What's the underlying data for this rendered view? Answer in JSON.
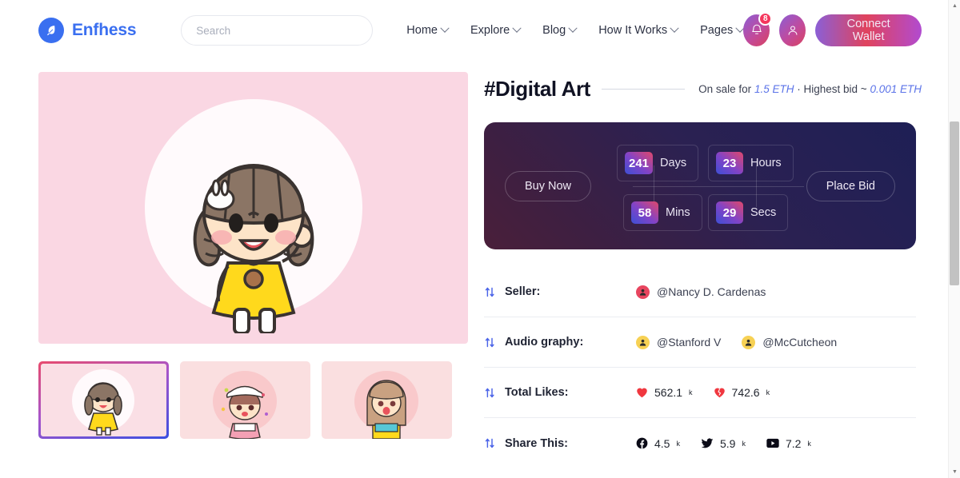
{
  "header": {
    "brand": "Enfhess",
    "brand_icon": "feather-logo-icon",
    "search": {
      "placeholder": "Search",
      "value": ""
    },
    "nav": [
      {
        "label": "Home",
        "has_dropdown": true
      },
      {
        "label": "Explore",
        "has_dropdown": true
      },
      {
        "label": "Blog",
        "has_dropdown": true
      },
      {
        "label": "How It Works",
        "has_dropdown": true
      },
      {
        "label": "Pages",
        "has_dropdown": true
      }
    ],
    "notification": {
      "icon": "bell-icon",
      "count": "8"
    },
    "profile": {
      "icon": "user-icon"
    },
    "wallet_button": "Connect Wallet",
    "accent_gradient_start": "#8b5fd6",
    "accent_gradient_end": "#e0435d"
  },
  "gallery": {
    "main_image_alt": "chibi-girl-yellow-dress",
    "thumbnails": [
      {
        "alt": "chibi-girl-yellow-dress",
        "selected": true
      },
      {
        "alt": "chibi-girl-chef-hat",
        "selected": false
      },
      {
        "alt": "chibi-girl-long-hair",
        "selected": false
      }
    ]
  },
  "detail": {
    "title": "#Digital Art",
    "price_prefix": "On sale for",
    "price": "1.5 ETH",
    "bid_separator": "·",
    "bid_prefix": "Highest bid ~",
    "highest_bid": "0.001 ETH"
  },
  "auction": {
    "buy_now_label": "Buy Now",
    "place_bid_label": "Place Bid",
    "countdown": [
      {
        "value": "241",
        "unit": "Days"
      },
      {
        "value": "23",
        "unit": "Hours"
      },
      {
        "value": "58",
        "unit": "Mins"
      },
      {
        "value": "29",
        "unit": "Secs"
      }
    ]
  },
  "info_rows": [
    {
      "icon": "transfer-arrows-icon",
      "label": "Seller:",
      "type": "people",
      "people": [
        {
          "avatar": "👤",
          "avatar_bg": "#e8455f",
          "handle": "@Nancy D. Cardenas"
        }
      ]
    },
    {
      "icon": "transfer-arrows-icon",
      "label": "Audio graphy:",
      "type": "people",
      "people": [
        {
          "avatar": "👤",
          "avatar_bg": "#f7d154",
          "handle": "@Stanford V"
        },
        {
          "avatar": "👤",
          "avatar_bg": "#f7d154",
          "handle": "@McCutcheon"
        }
      ]
    },
    {
      "icon": "transfer-arrows-icon",
      "label": "Total Likes:",
      "type": "stats",
      "stats": [
        {
          "icon": "heart-icon",
          "value": "562.1",
          "suffix": "k"
        },
        {
          "icon": "broken-heart-icon",
          "value": "742.6",
          "suffix": "k"
        }
      ]
    },
    {
      "icon": "transfer-arrows-icon",
      "label": "Share This:",
      "type": "stats",
      "stats": [
        {
          "icon": "facebook-icon",
          "value": "4.5",
          "suffix": "k"
        },
        {
          "icon": "twitter-icon",
          "value": "5.9",
          "suffix": "k"
        },
        {
          "icon": "youtube-icon",
          "value": "7.2",
          "suffix": "k"
        }
      ]
    }
  ],
  "scrollbar": {
    "up_arrow": "▲",
    "down_arrow": "▼"
  }
}
